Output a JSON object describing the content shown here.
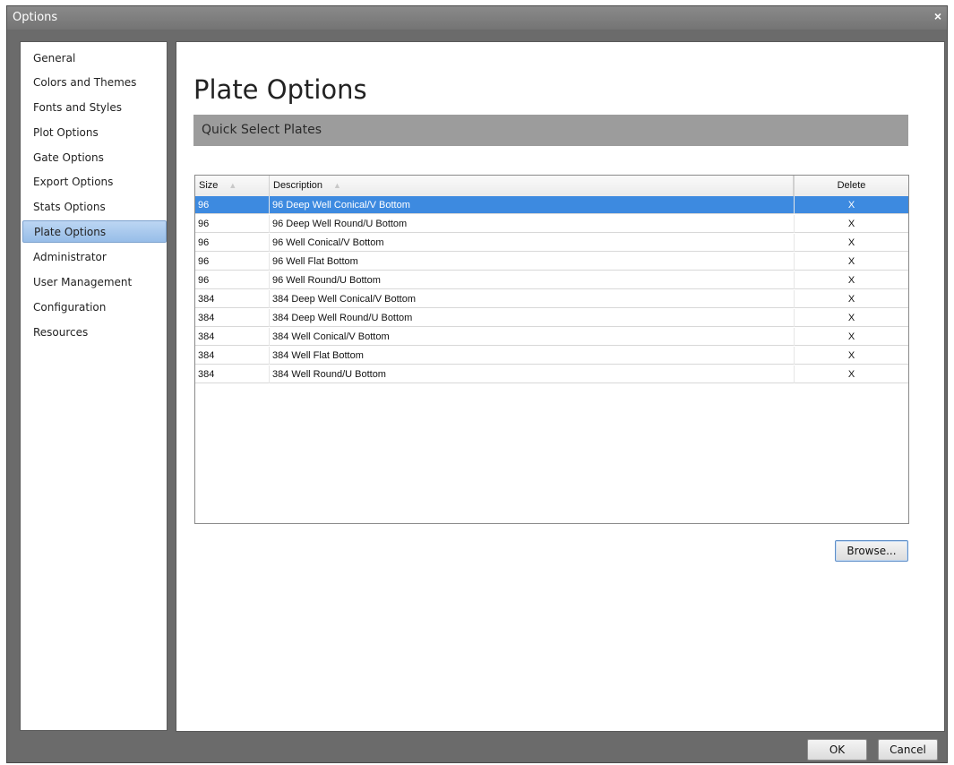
{
  "window": {
    "title": "Options",
    "close_glyph": "×"
  },
  "sidebar": {
    "items": [
      {
        "label": "General"
      },
      {
        "label": "Colors and Themes"
      },
      {
        "label": "Fonts and Styles"
      },
      {
        "label": "Plot Options"
      },
      {
        "label": "Gate Options"
      },
      {
        "label": "Export Options"
      },
      {
        "label": "Stats Options"
      },
      {
        "label": "Plate Options",
        "selected": true
      },
      {
        "label": "Administrator"
      },
      {
        "label": "User Management"
      },
      {
        "label": "Configuration"
      },
      {
        "label": "Resources"
      }
    ]
  },
  "main": {
    "title": "Plate Options",
    "section_title": "Quick Select Plates",
    "grid": {
      "columns": [
        "Size",
        "Description",
        "Delete"
      ],
      "sort_glyph": "▲",
      "rows": [
        {
          "size": "96",
          "description": "96 Deep Well Conical/V Bottom",
          "delete": "X",
          "selected": true
        },
        {
          "size": "96",
          "description": "96 Deep Well Round/U Bottom",
          "delete": "X"
        },
        {
          "size": "96",
          "description": "96 Well Conical/V Bottom",
          "delete": "X"
        },
        {
          "size": "96",
          "description": "96 Well Flat Bottom",
          "delete": "X"
        },
        {
          "size": "96",
          "description": "96 Well Round/U Bottom",
          "delete": "X"
        },
        {
          "size": "384",
          "description": "384 Deep Well Conical/V Bottom",
          "delete": "X"
        },
        {
          "size": "384",
          "description": "384 Deep Well Round/U Bottom",
          "delete": "X"
        },
        {
          "size": "384",
          "description": "384 Well Conical/V Bottom",
          "delete": "X"
        },
        {
          "size": "384",
          "description": "384 Well Flat Bottom",
          "delete": "X"
        },
        {
          "size": "384",
          "description": "384 Well Round/U Bottom",
          "delete": "X"
        }
      ]
    },
    "browse_label": "Browse..."
  },
  "footer": {
    "ok_label": "OK",
    "cancel_label": "Cancel"
  },
  "colors": {
    "selection": "#3d8ae0",
    "window_chrome": "#6b6b6b",
    "section_bar": "#9c9c9c"
  }
}
